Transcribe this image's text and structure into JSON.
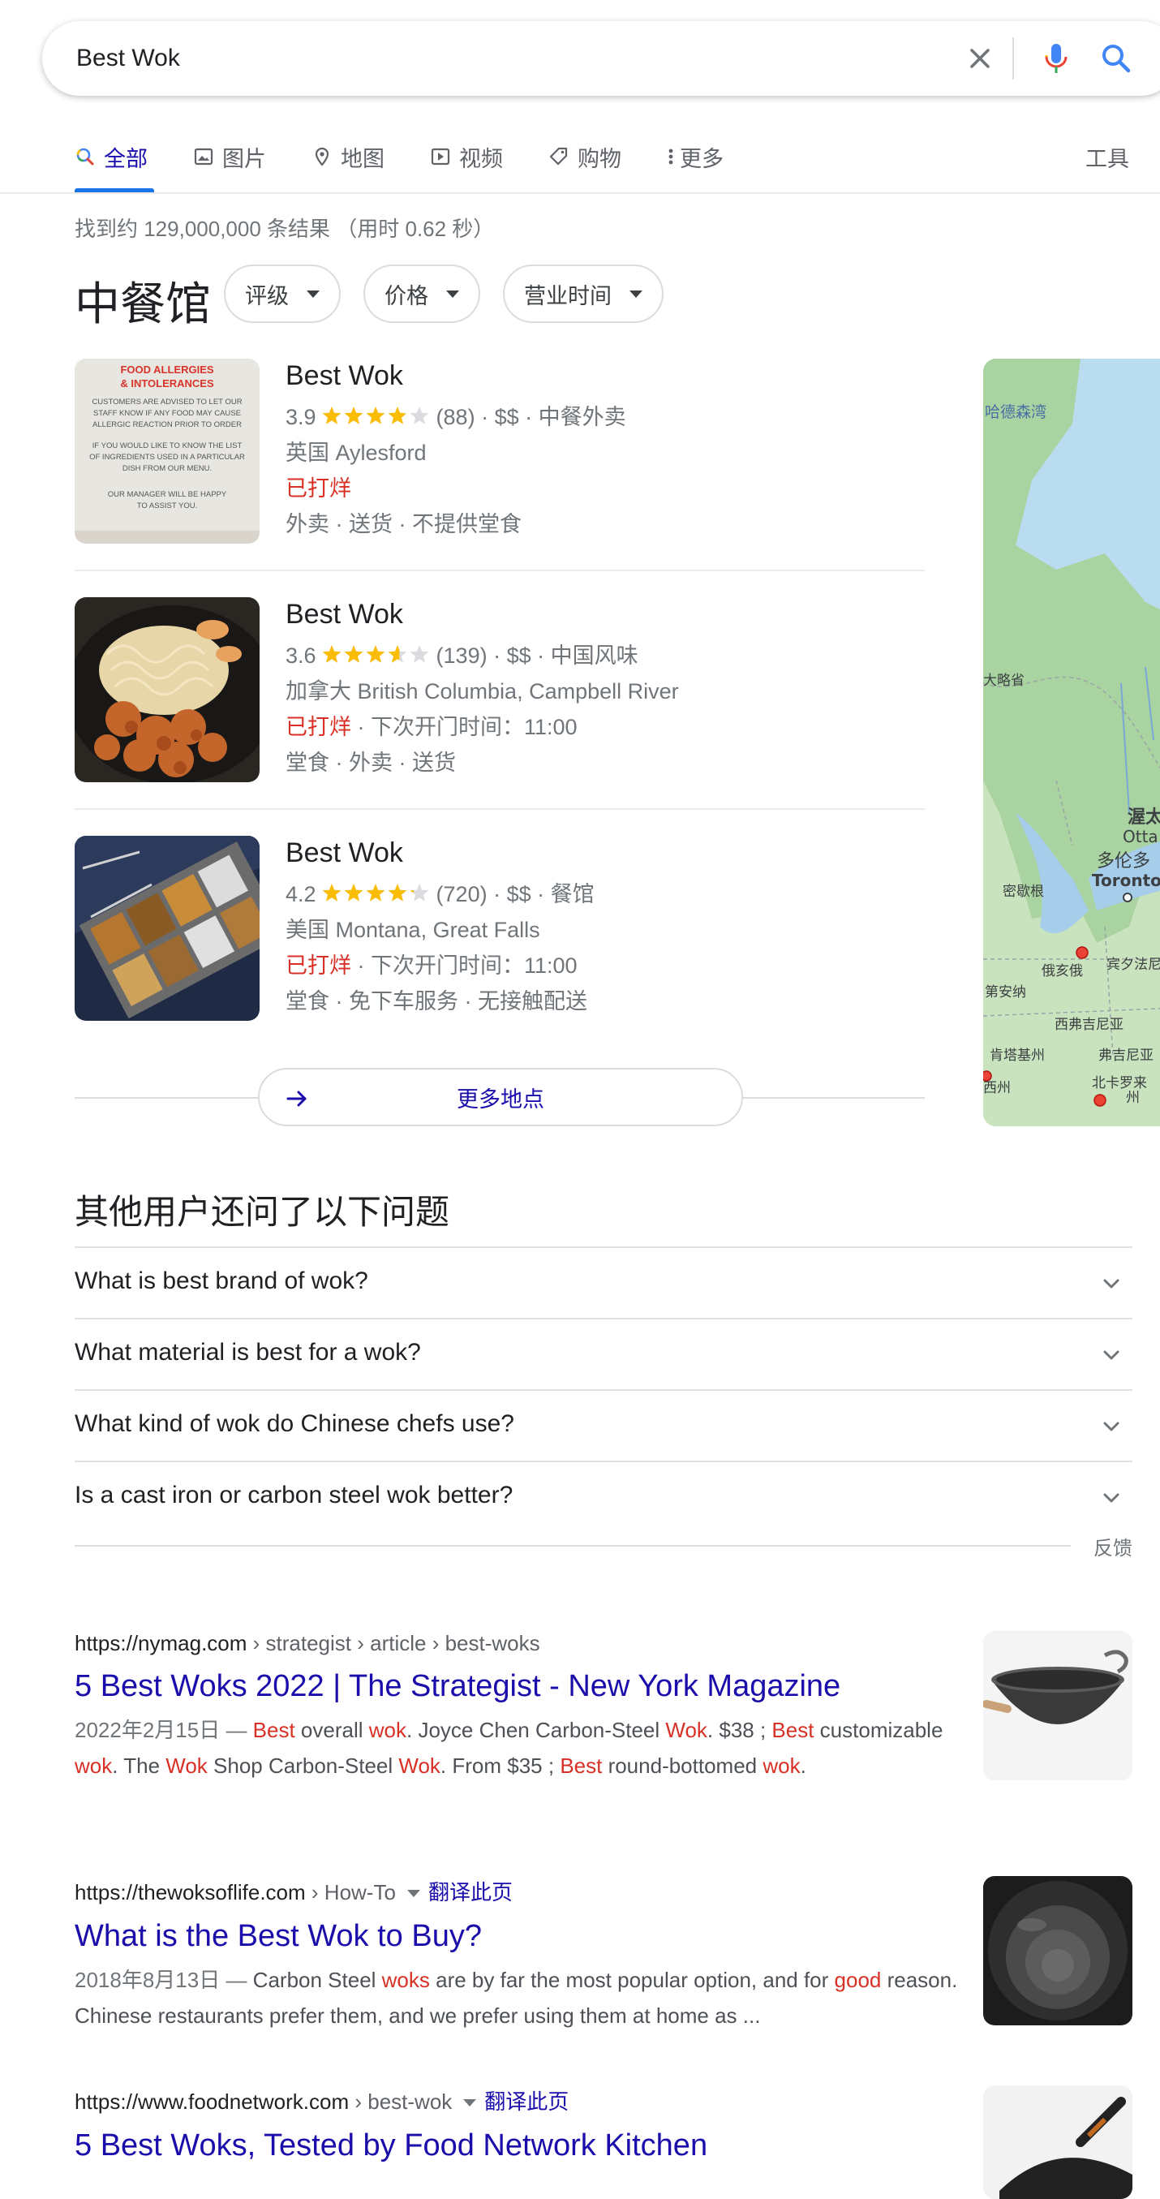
{
  "search": {
    "query": "Best Wok",
    "clear_icon": "close-icon",
    "mic_icon": "microphone-icon",
    "search_icon": "magnifier-icon"
  },
  "tabs": [
    {
      "label": "全部",
      "icon": "search-icon",
      "active": true
    },
    {
      "label": "图片",
      "icon": "image-icon"
    },
    {
      "label": "地图",
      "icon": "map-pin-icon"
    },
    {
      "label": "视频",
      "icon": "video-icon"
    },
    {
      "label": "购物",
      "icon": "tag-icon"
    },
    {
      "label": "更多",
      "icon": "more-vert-icon"
    }
  ],
  "tools_label": "工具",
  "result_stats": "找到约 129,000,000 条结果 （用时 0.62 秒）",
  "local": {
    "title": "中餐馆",
    "filters": [
      "评级",
      "价格",
      "营业时间"
    ],
    "places": [
      {
        "name": "Best Wok",
        "rating": "3.9",
        "rating_value": 3.9,
        "reviews": "(88)",
        "details": "· $$ · 中餐外卖",
        "address": "英国 Aylesford",
        "status": "已打烊",
        "hours": "",
        "services": "外卖 · 送货 · 不提供堂食",
        "thumb_text": {
          "heading": "FOOD ALLERGIES & INTOLERANCES",
          "body": "CUSTOMERS ARE ADVISED TO LET OUR STAFF KNOW IF ANY FOOD MAY CAUSE ALLERGIC REACTION PRIOR TO ORDER",
          "body2": "IF YOU WOULD LIKE TO KNOW THE LIST OF INGREDIENTS USED IN A PARTICULAR DISH FROM OUR MENU.",
          "footer": "OUR MANAGER WILL BE HAPPY TO ASSIST YOU."
        }
      },
      {
        "name": "Best Wok",
        "rating": "3.6",
        "rating_value": 3.6,
        "reviews": "(139)",
        "details": "· $$ · 中国风味",
        "address": "加拿大 British Columbia, Campbell River",
        "status": "已打烊",
        "hours": " · 下次开门时间：11:00",
        "services": "堂食 · 外卖 · 送货"
      },
      {
        "name": "Best Wok",
        "rating": "4.2",
        "rating_value": 4.2,
        "reviews": "(720)",
        "details": "· $$ · 餐馆",
        "address": "美国 Montana, Great Falls",
        "status": "已打烊",
        "hours": " · 下次开门时间：11:00",
        "services": "堂食 · 免下车服务 · 无接触配送"
      }
    ],
    "more_places_label": "更多地点",
    "map_labels": [
      "哈德森湾",
      "大略省",
      "渥太",
      "Otta",
      "多伦多",
      "Toronto",
      "密歇根",
      "俄亥俄",
      "宾夕法尼",
      "第安纳",
      "西弗吉尼亚",
      "肯塔基州",
      "弗吉尼亚",
      "西州",
      "北卡罗来",
      "州"
    ]
  },
  "paa": {
    "title": "其他用户还问了以下问题",
    "questions": [
      "What is best brand of wok?",
      "What material is best for a wok?",
      "What kind of wok do Chinese chefs use?",
      "Is a cast iron or carbon steel wok better?"
    ],
    "feedback": "反馈"
  },
  "results": [
    {
      "domain": "https://nymag.com",
      "path": " › strategist › article › best-woks",
      "translate": "",
      "title": "5 Best Woks 2022 | The Strategist - New York Magazine",
      "date": "2022年2月15日 — ",
      "snippet": [
        {
          "t": "Best",
          "h": true
        },
        {
          "t": " overall "
        },
        {
          "t": "wok",
          "h": true
        },
        {
          "t": ". Joyce Chen Carbon-Steel "
        },
        {
          "t": "Wok",
          "h": true
        },
        {
          "t": ". $38 ; "
        },
        {
          "t": "Best",
          "h": true
        },
        {
          "t": " customizable "
        },
        {
          "t": "wok",
          "h": true
        },
        {
          "t": ". The "
        },
        {
          "t": "Wok",
          "h": true
        },
        {
          "t": " Shop Carbon-Steel "
        },
        {
          "t": "Wok",
          "h": true
        },
        {
          "t": ". From $35 ; "
        },
        {
          "t": "Best",
          "h": true
        },
        {
          "t": " round-bottomed "
        },
        {
          "t": "wok",
          "h": true
        },
        {
          "t": "."
        }
      ]
    },
    {
      "domain": "https://thewoksoflife.com",
      "path": " › How-To",
      "translate": "翻译此页",
      "title": "What is the Best Wok to Buy?",
      "date": "2018年8月13日 — ",
      "snippet": [
        {
          "t": "Carbon Steel "
        },
        {
          "t": "woks",
          "h": true
        },
        {
          "t": " are by far the most popular option, and for "
        },
        {
          "t": "good",
          "h": true
        },
        {
          "t": " reason. Chinese restaurants prefer them, and we prefer using them at home as ..."
        }
      ]
    },
    {
      "domain": "https://www.foodnetwork.com",
      "path": " › best-wok",
      "translate": "翻译此页",
      "title": "5 Best Woks, Tested by Food Network Kitchen",
      "date": "",
      "snippet": []
    }
  ],
  "colors": {
    "link": "#1a0dab",
    "accent": "#1a73e8",
    "closed": "#d93025",
    "star": "#fbbc04"
  }
}
